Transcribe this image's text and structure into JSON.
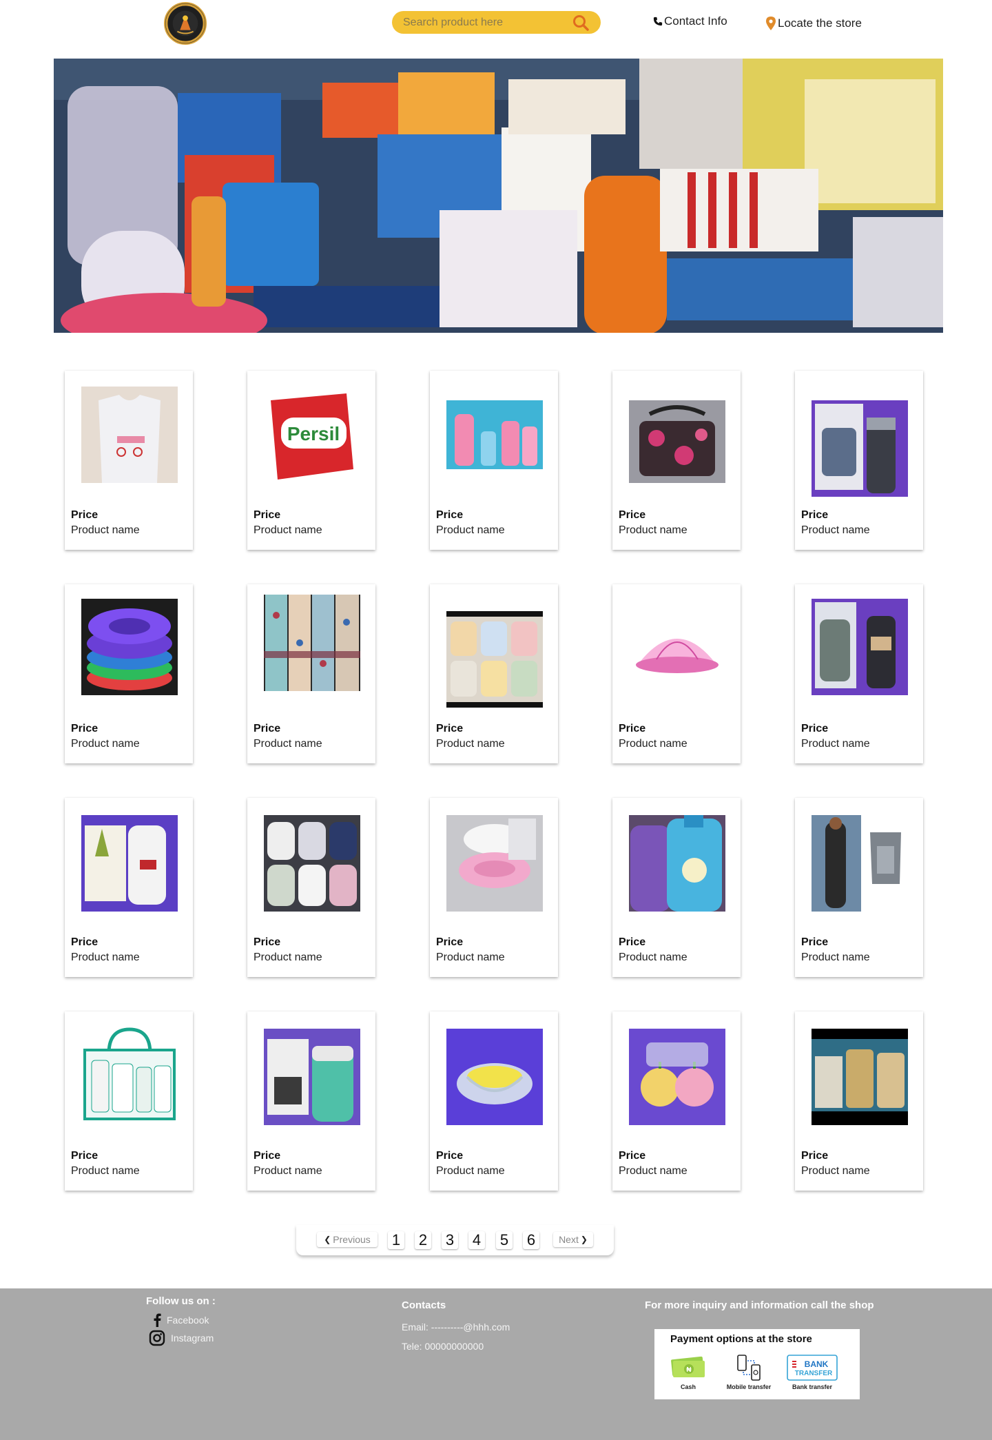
{
  "header": {
    "search_placeholder": "Search product here",
    "contact_label": "Contact Info",
    "locate_label": "Locate the store"
  },
  "colors": {
    "accent": "#f3c234",
    "search_icon": "#e06b1f",
    "pin": "#e08b2b",
    "footer_bg": "#a9a9a9"
  },
  "products": [
    {
      "price": "Price",
      "name": "Product name",
      "icon": "nursing-tshirt-image"
    },
    {
      "price": "Price",
      "name": "Product name",
      "icon": "persil-detergent-image"
    },
    {
      "price": "Price",
      "name": "Product name",
      "icon": "baby-lotion-bottles-image"
    },
    {
      "price": "Price",
      "name": "Product name",
      "icon": "diaper-bag-image"
    },
    {
      "price": "Price",
      "name": "Product name",
      "icon": "vacuum-flask-image"
    },
    {
      "price": "Price",
      "name": "Product name",
      "icon": "stacked-potties-image"
    },
    {
      "price": "Price",
      "name": "Product name",
      "icon": "printed-fabrics-image"
    },
    {
      "price": "Price",
      "name": "Product name",
      "icon": "baby-blankets-image"
    },
    {
      "price": "Price",
      "name": "Product name",
      "icon": "baby-mosquito-net-image"
    },
    {
      "price": "Price",
      "name": "Product name",
      "icon": "lunch-box-flasks-image"
    },
    {
      "price": "Price",
      "name": "Product name",
      "icon": "food-flask-image"
    },
    {
      "price": "Price",
      "name": "Product name",
      "icon": "baby-bibs-image"
    },
    {
      "price": "Price",
      "name": "Product name",
      "icon": "sitz-bath-image"
    },
    {
      "price": "Price",
      "name": "Product name",
      "icon": "comfort-softener-image"
    },
    {
      "price": "Price",
      "name": "Product name",
      "icon": "baby-carrier-image"
    },
    {
      "price": "Price",
      "name": "Product name",
      "icon": "toiletries-gift-set-image"
    },
    {
      "price": "Price",
      "name": "Product name",
      "icon": "milan-flask-set-image"
    },
    {
      "price": "Price",
      "name": "Product name",
      "icon": "baby-feeding-bowl-image"
    },
    {
      "price": "Price",
      "name": "Product name",
      "icon": "apple-containers-image"
    },
    {
      "price": "Price",
      "name": "Product name",
      "icon": "aveeno-set-image"
    }
  ],
  "pagination": {
    "previous": "Previous",
    "next": "Next",
    "pages": [
      "1",
      "2",
      "3",
      "4",
      "5",
      "6"
    ]
  },
  "footer": {
    "follow_heading": "Follow us on :",
    "facebook": "Facebook",
    "instagram": "Instagram",
    "contacts_heading": "Contacts",
    "email": "Email: ----------@hhh.com",
    "phone": "Tele: 00000000000",
    "inquiry_heading": "For more inquiry and information call the shop",
    "payment_title": "Payment options at the store",
    "payment_options": [
      "Cash",
      "Mobile transfer",
      "Bank transfer"
    ],
    "bank_logo_text": [
      "BANK",
      "TRANSFER"
    ]
  }
}
